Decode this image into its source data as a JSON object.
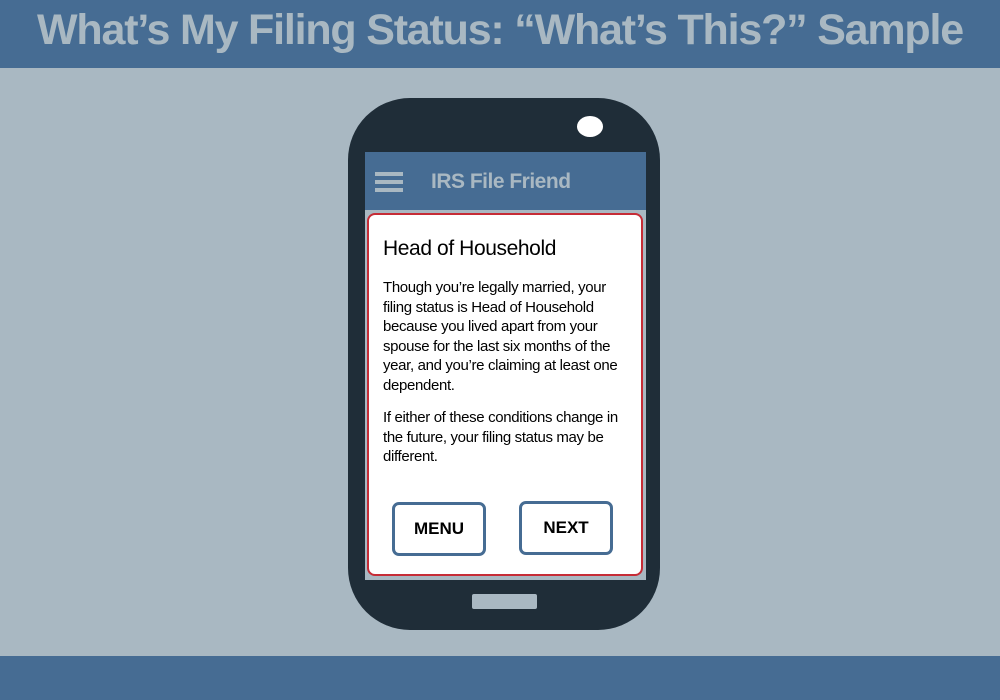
{
  "slide": {
    "title": "What’s My Filing Status: “What’s This?” Sample"
  },
  "app": {
    "title": "IRS File Friend",
    "menu_icon": "hamburger-menu-icon"
  },
  "dialog": {
    "heading": "Head of Household",
    "paragraphs": [
      "Though you’re legally married, your filing status is Head of Household because you lived apart from your spouse for the last six months of the year, and you’re claiming at least one dependent.",
      "If either of these conditions change in the future, your filing status may be different."
    ],
    "buttons": {
      "menu": "MENU",
      "next": "NEXT"
    }
  },
  "colors": {
    "banner": "#466c93",
    "background": "#a9b8c2",
    "phone_body": "#1f2d38",
    "dialog_border": "#c62c36",
    "button_border": "#466c93"
  }
}
